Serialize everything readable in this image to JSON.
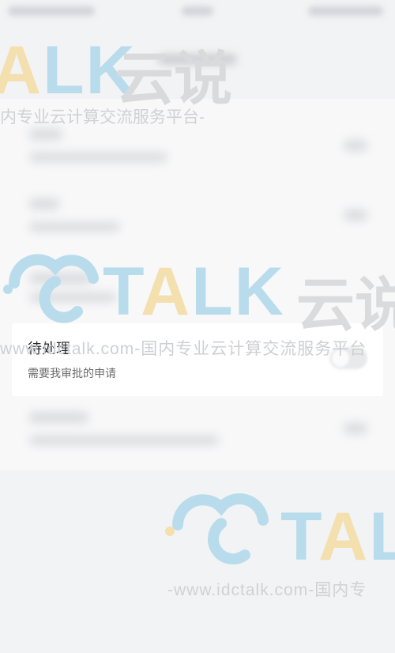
{
  "dialog": {
    "title": "待处理",
    "subtitle": "需要我审批的申请"
  },
  "watermark": {
    "brand_cn": "云说",
    "brand_en_1": "LK",
    "brand_en_2": "TALK",
    "brand_en_3": "TAL",
    "tagline_1": "内专业云计算交流服务平台-",
    "tagline_2": "www.idctalk.com-国内专业云计算交流服务平台",
    "tagline_3": "-www.idctalk.com-国内专",
    "colors": {
      "blue": "#b9dcec",
      "yellow": "#f4dfae",
      "gray": "#dfe0e2"
    }
  },
  "icons": {
    "watermark_logo": "idctalk-logo-icon",
    "toggle": "toggle-switch"
  }
}
